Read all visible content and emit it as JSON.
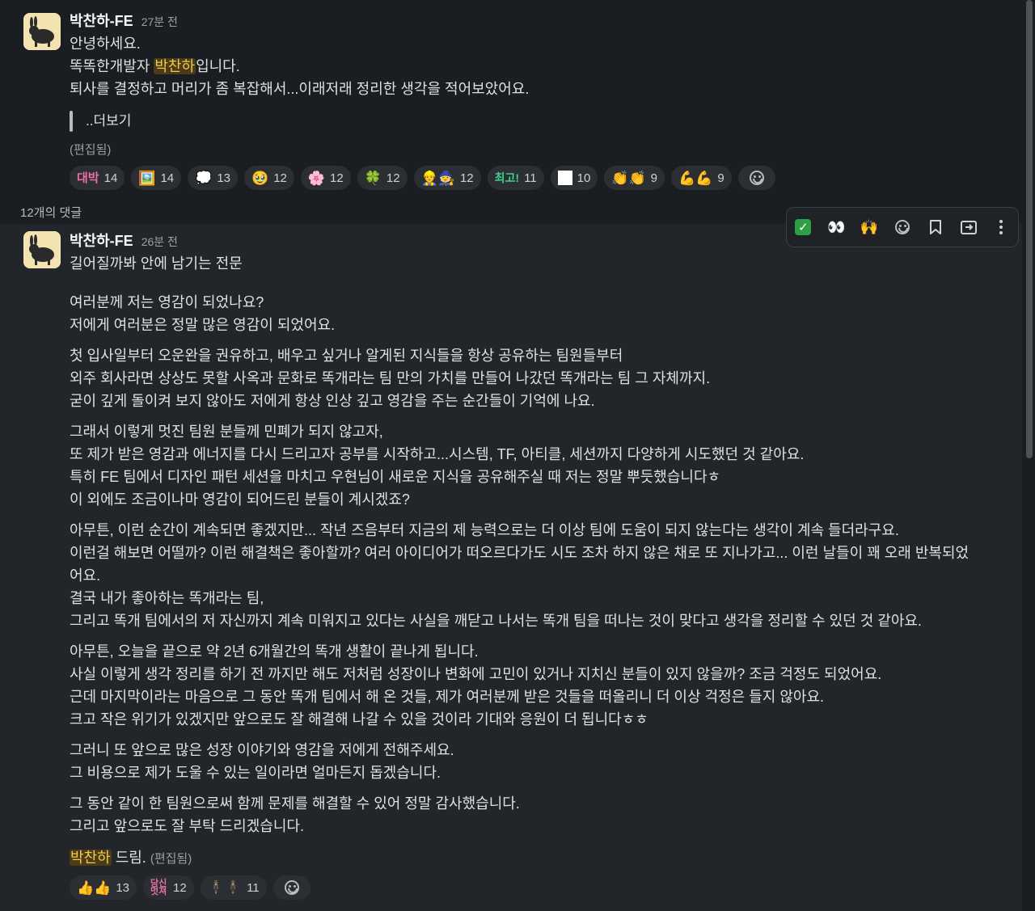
{
  "post": {
    "author": "박찬하-FE",
    "time": "27분 전",
    "lines": [
      "안녕하세요."
    ],
    "line2_pre": "똑똑한개발자 ",
    "line2_mention": "박찬하",
    "line2_post": "입니다.",
    "line3": "퇴사를 결정하고 머리가 좀 복잡해서...이래저래 정리한 생각을 적어보았어요.",
    "quote": "..더보기",
    "edited": "(편집됨)",
    "reactions": [
      {
        "emoji": "대박",
        "count": "14",
        "color": "#e86fa8"
      },
      {
        "emoji": "🖼️",
        "count": "14"
      },
      {
        "emoji": "💭",
        "count": "13"
      },
      {
        "emoji": "🥹",
        "count": "12"
      },
      {
        "emoji": "🌸",
        "count": "12"
      },
      {
        "emoji": "🍀",
        "count": "12"
      },
      {
        "emoji": "👷🧙",
        "count": "12"
      },
      {
        "emoji": "최고!",
        "count": "11",
        "color": "#3fd18f"
      },
      {
        "emoji": "⬜",
        "count": "10"
      },
      {
        "emoji": "👏👏",
        "count": "9"
      },
      {
        "emoji": "💪💪",
        "count": "9"
      }
    ]
  },
  "reply_count": "12개의 댓글",
  "reply": {
    "author": "박찬하-FE",
    "time": "26분 전",
    "intro": "길어질까봐 안에 남기는 전문",
    "paragraphs": [
      [
        "여러분께 저는 영감이 되었나요?",
        "저에게 여러분은 정말 많은 영감이 되었어요."
      ],
      [
        "첫 입사일부터 오운완을 권유하고, 배우고 싶거나 알게된 지식들을 항상 공유하는 팀원들부터",
        "외주 회사라면 상상도 못할 사옥과 문화로 똑개라는 팀 만의 가치를 만들어 나갔던 똑개라는 팀 그 자체까지.",
        "굳이 깊게 돌이켜 보지 않아도 저에게 항상 인상 깊고 영감을 주는 순간들이 기억에 나요."
      ],
      [
        "그래서 이렇게 멋진 팀원 분들께 민폐가 되지 않고자,",
        "또 제가 받은 영감과 에너지를 다시 드리고자 공부를 시작하고...시스템, TF, 아티클, 세션까지 다양하게 시도했던 것 같아요.",
        "특히 FE 팀에서 디자인 패턴 세션을 마치고 우현님이 새로운 지식을 공유해주실 때 저는 정말 뿌듯했습니다ㅎ",
        "이 외에도 조금이나마 영감이 되어드린 분들이 계시겠죠?"
      ],
      [
        "아무튼, 이런 순간이 계속되면 좋겠지만... 작년 즈음부터 지금의 제 능력으로는 더 이상 팀에 도움이 되지 않는다는 생각이 계속 들더라구요.",
        "이런걸 해보면 어떨까? 이런 해결책은 좋아할까? 여러 아이디어가 떠오르다가도 시도 조차 하지 않은 채로 또 지나가고... 이런 날들이 꽤 오래 반복되었",
        "어요.",
        "결국 내가 좋아하는 똑개라는 팀,",
        "그리고 똑개 팀에서의 저 자신까지 계속 미워지고 있다는 사실을 깨닫고 나서는 똑개 팀을 떠나는 것이 맞다고 생각을 정리할 수 있던 것 같아요."
      ],
      [
        "아무튼, 오늘을 끝으로 약 2년 6개월간의 똑개 생활이 끝나게 됩니다.",
        "사실 이렇게 생각 정리를 하기 전 까지만 해도 저처럼 성장이나 변화에 고민이 있거나 지치신 분들이 있지 않을까? 조금 걱정도 되었어요.",
        "근데 마지막이라는 마음으로 그 동안 똑개 팀에서 해 온 것들, 제가 여러분께 받은 것들을 떠올리니 더 이상 걱정은 들지 않아요.",
        "크고 작은 위기가 있겠지만 앞으로도 잘 해결해 나갈 수 있을 것이라 기대와 응원이 더 됩니다ㅎㅎ"
      ],
      [
        "그러니 또 앞으로 많은 성장 이야기와 영감을 저에게 전해주세요.",
        "그 비용으로 제가 도울 수 있는 일이라면 얼마든지 돕겠습니다."
      ],
      [
        "그 동안 같이 한 팀원으로써 함께 문제를 해결할 수 있어 정말 감사했습니다.",
        "그리고 앞으로도 잘 부탁 드리겠습니다."
      ]
    ],
    "sign_mention": "박찬하",
    "sign_post": " 드림.",
    "edited": "(편집됨)",
    "reactions": [
      {
        "emoji": "👍👍",
        "count": "13"
      },
      {
        "emoji": "당신멋져",
        "count": "12",
        "color": "#e86fa8"
      },
      {
        "emoji": "🕴️🕴️",
        "count": "11"
      }
    ]
  }
}
